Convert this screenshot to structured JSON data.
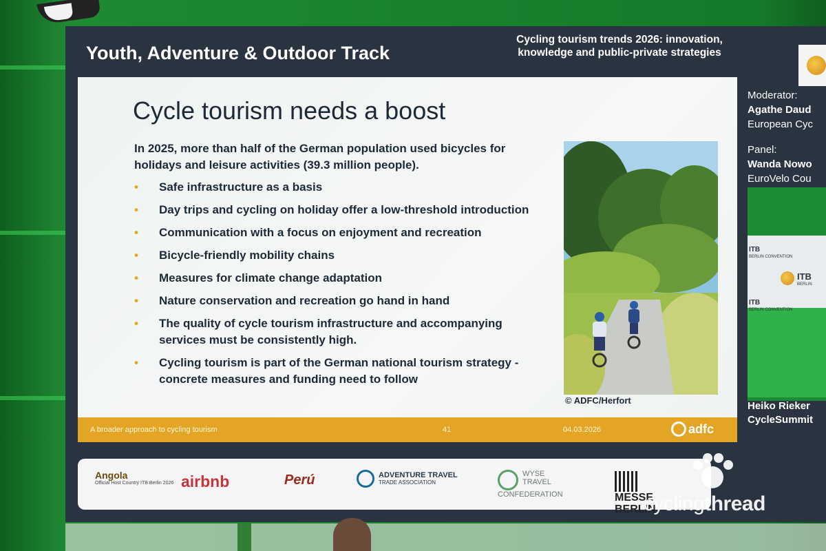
{
  "screen": {
    "track_title": "Youth, Adventure & Outdoor Track",
    "session_title": "Cycling tourism trends 2026: innovation, knowledge and public-private strategies"
  },
  "sidebar": {
    "moderator_label": "Moderator:",
    "moderator_name": "Agathe Daud",
    "moderator_org": "European Cyc",
    "panel_label": "Panel:",
    "panel_name": "Wanda Nowo",
    "panel_org": "EuroVelo Cou",
    "speaker_name": "Heiko Rieker",
    "speaker_org": "CycleSummit",
    "itb_1": "ITB",
    "itb_1_sub": "BERLIN CONVENTION",
    "itb_2": "ITB",
    "itb_2_sub": "BERLIN",
    "itb_3": "ITB",
    "itb_3_sub": "BERLIN CONVENTION"
  },
  "slide": {
    "heading": "Cycle tourism needs a boost",
    "intro": "In 2025, more than half of the German population used bicycles for holidays and leisure activities (39.3 million people).",
    "bullets": [
      "Safe infrastructure as a basis",
      "Day trips and cycling on holiday offer a low-threshold introduction",
      "Communication with a focus on enjoyment and recreation",
      "Bicycle-friendly mobility chains",
      "Measures for climate change adaptation",
      "Nature conservation and recreation go hand in hand",
      "The quality of cycle tourism infrastructure and accompanying services must be consistently high.",
      "Cycling tourism is part of the German national tourism strategy - concrete measures and funding need to follow"
    ],
    "bullet_glyph": "•",
    "photo_credit": "© ADFC/Herfort",
    "footer_left": "A broader approach to cycling tourism",
    "footer_page": "41",
    "footer_date": "04.03.2026",
    "footer_logo": "adfc"
  },
  "sponsors": {
    "angola": "Angola",
    "angola_sub": "Official Host Country ITB Berlin 2026",
    "airbnb": "airbnb",
    "peru": "Perú",
    "atta": "ADVENTURE TRAVEL",
    "atta_sub": "TRADE ASSOCIATION",
    "wyse_1": "WYSE",
    "wyse_2": "TRAVEL",
    "wyse_3": "CONFEDERATION",
    "messe_1": "MESSE",
    "messe_2": "BERLIN"
  },
  "watermark": {
    "part1": "cycling",
    "part2": "thread"
  },
  "colors": {
    "footer_bar": "#e3a523",
    "bullet": "#e0a81c",
    "stage_green": "#1f8a32"
  }
}
